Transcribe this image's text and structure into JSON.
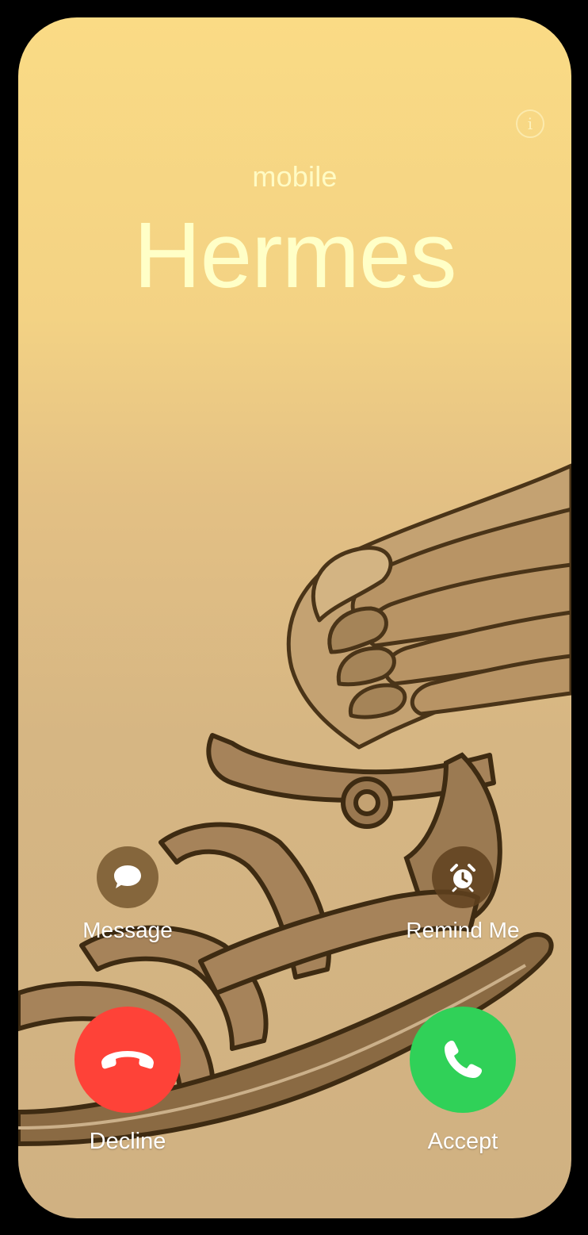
{
  "call": {
    "label": "mobile",
    "caller_name": "Hermes"
  },
  "icons": {
    "info": "info-icon",
    "message": "message-bubble-icon",
    "remind": "alarm-clock-icon",
    "decline": "phone-down-icon",
    "accept": "phone-icon"
  },
  "actions": {
    "message_label": "Message",
    "remind_label": "Remind Me",
    "decline_label": "Decline",
    "accept_label": "Accept"
  },
  "colors": {
    "decline": "#fe4238",
    "accept": "#30d158",
    "name_text": "#ffffc7"
  }
}
